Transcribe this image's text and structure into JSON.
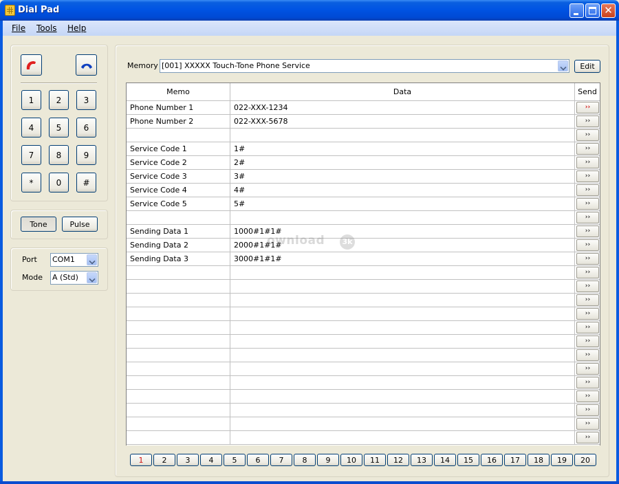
{
  "window": {
    "title": "Dial Pad"
  },
  "menu": [
    {
      "label": "File"
    },
    {
      "label": "Tools"
    },
    {
      "label": "Help"
    }
  ],
  "hook": {
    "off_hook_icon": "phone-off-hook-icon",
    "on_hook_icon": "phone-on-hook-icon",
    "off_hook_color": "#e02020",
    "on_hook_color": "#1040c0"
  },
  "keypad": [
    "1",
    "2",
    "3",
    "4",
    "5",
    "6",
    "7",
    "8",
    "9",
    "*",
    "0",
    "#"
  ],
  "dial_mode": {
    "tone_label": "Tone",
    "pulse_label": "Pulse",
    "selected": "Tone"
  },
  "settings": {
    "port_label": "Port",
    "port_value": "COM1",
    "mode_label": "Mode",
    "mode_value": "A (Std)"
  },
  "memory": {
    "label": "Memory",
    "selected": "[001] XXXXX Touch-Tone Phone Service",
    "edit_label": "Edit"
  },
  "table": {
    "headers": {
      "memo": "Memo",
      "data": "Data",
      "send": "Send"
    },
    "send_glyph": "››",
    "rows": [
      {
        "memo": "Phone Number 1",
        "data": "022-XXX-1234"
      },
      {
        "memo": "Phone Number 2",
        "data": "022-XXX-5678"
      },
      {
        "memo": "",
        "data": ""
      },
      {
        "memo": "Service Code 1",
        "data": "1#"
      },
      {
        "memo": "Service Code 2",
        "data": "2#"
      },
      {
        "memo": "Service Code 3",
        "data": "3#"
      },
      {
        "memo": "Service Code 4",
        "data": "4#"
      },
      {
        "memo": "Service Code 5",
        "data": "5#"
      },
      {
        "memo": "",
        "data": ""
      },
      {
        "memo": "Sending Data 1",
        "data": "1000#1#1#"
      },
      {
        "memo": "Sending Data 2",
        "data": "2000#1#1#"
      },
      {
        "memo": "Sending Data 3",
        "data": "3000#1#1#"
      },
      {
        "memo": "",
        "data": ""
      },
      {
        "memo": "",
        "data": ""
      },
      {
        "memo": "",
        "data": ""
      },
      {
        "memo": "",
        "data": ""
      },
      {
        "memo": "",
        "data": ""
      },
      {
        "memo": "",
        "data": ""
      },
      {
        "memo": "",
        "data": ""
      },
      {
        "memo": "",
        "data": ""
      },
      {
        "memo": "",
        "data": ""
      },
      {
        "memo": "",
        "data": ""
      },
      {
        "memo": "",
        "data": ""
      },
      {
        "memo": "",
        "data": ""
      },
      {
        "memo": "",
        "data": ""
      }
    ]
  },
  "pages": [
    "1",
    "2",
    "3",
    "4",
    "5",
    "6",
    "7",
    "8",
    "9",
    "10",
    "11",
    "12",
    "13",
    "14",
    "15",
    "16",
    "17",
    "18",
    "19",
    "20"
  ],
  "active_page": "1",
  "watermark": {
    "text": "ownload",
    "badge": "3k"
  }
}
